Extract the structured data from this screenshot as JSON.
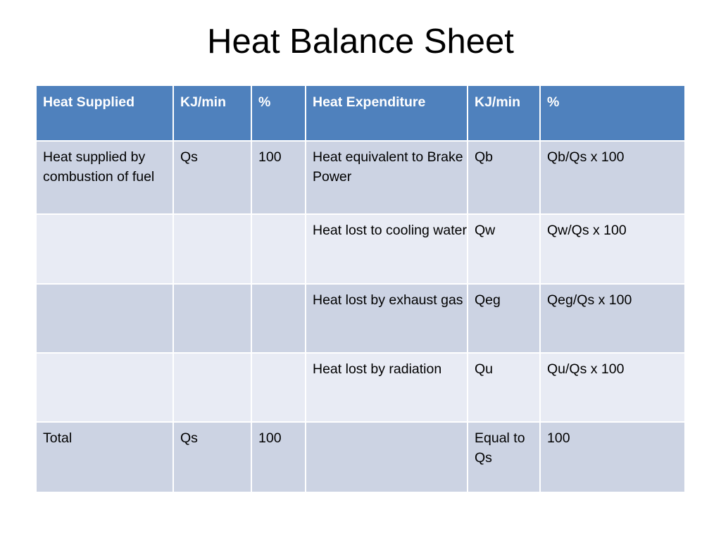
{
  "slide": {
    "title": "Heat Balance Sheet"
  },
  "colors": {
    "header_blue": "#4f81bd",
    "band_dark": "#ccd3e3",
    "band_light": "#e8ebf4",
    "header_text": "#ffffff",
    "body_text": "#000000",
    "background": "#ffffff"
  },
  "table": {
    "headers": [
      "Heat Supplied",
      "KJ/min",
      "%",
      "Heat Expenditure",
      "KJ/min",
      "%"
    ],
    "rows": [
      {
        "band": "dark",
        "cells": [
          "Heat supplied by combustion of fuel",
          "Qs",
          "100",
          "Heat equivalent to Brake Power",
          "Qb",
          "Qb/Qs x 100"
        ]
      },
      {
        "band": "light",
        "cells": [
          "",
          "",
          "",
          "Heat lost to cooling water",
          "Qw",
          "Qw/Qs x 100"
        ]
      },
      {
        "band": "dark",
        "cells": [
          "",
          "",
          "",
          "Heat lost by exhaust gas",
          "Qeg",
          "Qeg/Qs x 100"
        ]
      },
      {
        "band": "light",
        "cells": [
          "",
          "",
          "",
          "Heat lost by radiation",
          "Qu",
          "Qu/Qs x 100"
        ]
      },
      {
        "band": "dark",
        "cells": [
          "Total",
          "Qs",
          "100",
          "",
          "Equal to Qs",
          "100"
        ]
      }
    ]
  }
}
